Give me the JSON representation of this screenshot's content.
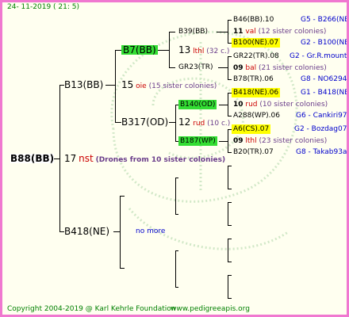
{
  "header": {
    "date": "24- 11-2019 ( 21:  5)"
  },
  "root": {
    "label": "B88(BB)",
    "num": "17",
    "mark": "nst",
    "note": "(Drones from 10 sister colonies)"
  },
  "gen1": {
    "sire": {
      "label": "B13(BB)",
      "num": "15",
      "mark": "oie",
      "note": "(15 sister colonies)"
    },
    "dam": {
      "label": "B418(NE)",
      "more": "no more"
    }
  },
  "gen2": {
    "b7": {
      "label": "B7(BB)"
    },
    "b317": {
      "label": "B317(OD)",
      "num": "12",
      "mark": "rud",
      "note": "(10 c.)"
    }
  },
  "gen3": {
    "b39": {
      "label": "B39(BB)",
      "num": "13",
      "mark": "lthl",
      "note": "(32 c.)"
    },
    "gr23": {
      "label": "GR23(TR)"
    },
    "b140": {
      "label": "B140(OD)",
      "num": "10",
      "mark": "rud",
      "note": "(10 sister colonies)"
    },
    "b187": {
      "label": "B187(WP)",
      "num": "09",
      "mark": "lthl",
      "note": "(23 sister colonies)"
    }
  },
  "gen4": [
    {
      "label": "B46(BB).10",
      "right": "G5 - B266(NE)"
    },
    {
      "num": "11",
      "mark": "val",
      "note": "(12 sister colonies)"
    },
    {
      "label": "B100(NE).07",
      "right": "G2 - B100(NE)"
    },
    {
      "label": "GR22(TR).08",
      "right": "G2 - Gr.R.mounta"
    },
    {
      "num": "09",
      "mark": "bal",
      "note": "(21 sister colonies)"
    },
    {
      "label": "B78(TR).06",
      "right": "G8 - NO6294R"
    },
    {
      "label": "B418(NE).06",
      "right": "G1 - B418(NE)"
    },
    {
      "num": "10",
      "mark": "rud",
      "note": "(10 sister colonies)"
    },
    {
      "label": "A288(WP).06",
      "right": "G6 - Cankiri97Q"
    },
    {
      "label": "A6(CS).07",
      "right": "G2 - Bozdag07R"
    },
    {
      "num": "09",
      "mark": "lthl",
      "note": "(23 sister colonies)"
    },
    {
      "label": "B20(TR).07",
      "right": "G8 - Takab93aR"
    }
  ],
  "footer": {
    "copyright": "Copyright 2004-2019 @ Karl Kehrle Foundation",
    "url": "www.pedigreeapis.org"
  },
  "colors": {
    "border": "#f078d0",
    "green_box": "#33dd33",
    "yellow_box": "#ffff00",
    "mark_red": "#cc0000",
    "note_purple": "#6a3d8a",
    "ref_blue": "#0000cc"
  }
}
